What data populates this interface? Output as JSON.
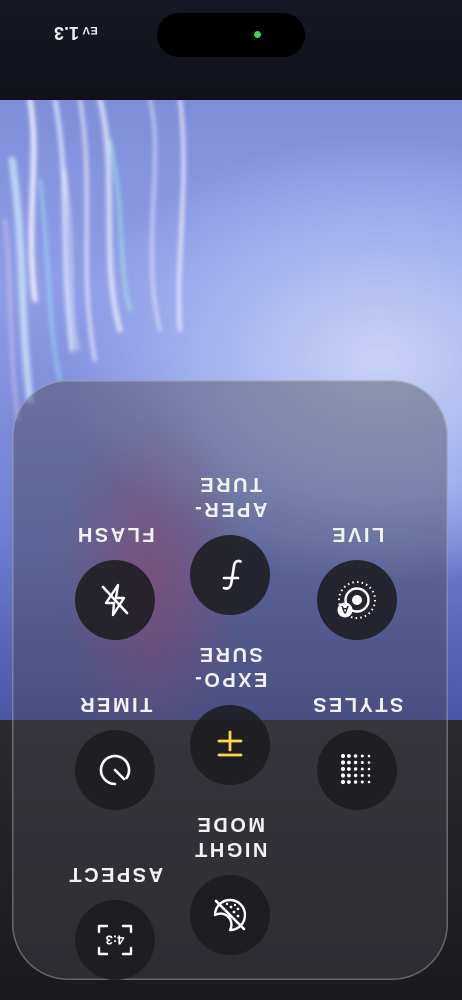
{
  "status": {
    "ev_label": "EV",
    "ev_value": "1.3"
  },
  "controls": [
    {
      "id": "flash",
      "label": "FLASH",
      "icon": "flash-off-icon"
    },
    {
      "id": "aperture",
      "label": "APER-\nTURE",
      "icon": "aperture-f-icon"
    },
    {
      "id": "live",
      "label": "LIVE",
      "icon": "live-photo-off-icon"
    },
    {
      "id": "timer",
      "label": "TIMER",
      "icon": "timer-icon"
    },
    {
      "id": "exposure",
      "label": "EXPO-\nSURE",
      "icon": "exposure-plus-minus-icon"
    },
    {
      "id": "styles",
      "label": "STYLES",
      "icon": "photographic-styles-icon"
    },
    {
      "id": "aspect",
      "label": "ASPECT",
      "icon": "aspect-ratio-icon",
      "value": "4:3"
    },
    {
      "id": "night",
      "label": "NIGHT\nMODE",
      "icon": "night-mode-off-icon"
    }
  ],
  "colors": {
    "accent": "#ffd84a",
    "status_dot": "#3bd35a"
  }
}
